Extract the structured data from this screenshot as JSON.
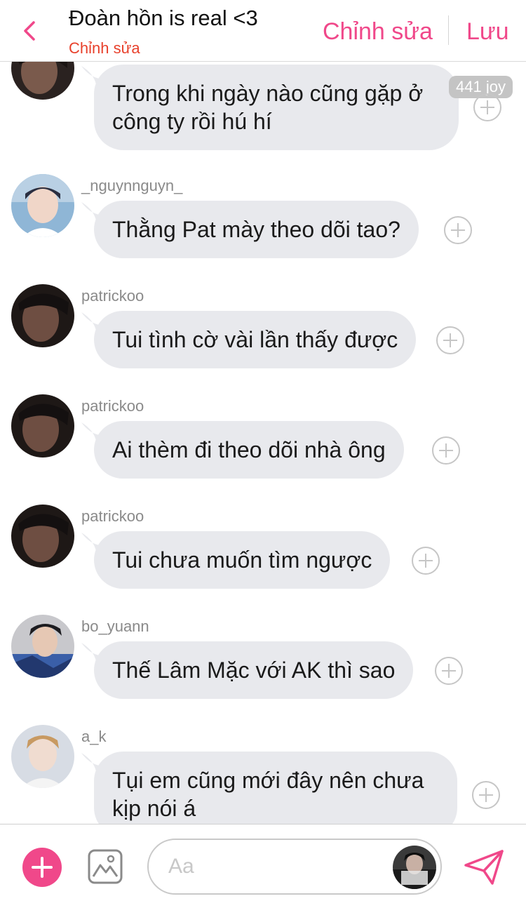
{
  "header": {
    "title": "Đoàn hồn is real <3",
    "subtitle": "Chỉnh sửa",
    "edit_label": "Chỉnh sửa",
    "save_label": "Lưu"
  },
  "messages": [
    {
      "username": "",
      "text_lines": [
        "Trong khi ngày nào cũng gặp ở",
        "công ty rồi hú hí"
      ],
      "badge": "441 joy",
      "avatar": "patrickoo"
    },
    {
      "username": "_nguynnguyn_",
      "text_lines": [
        "Thằng Pat mày theo dõi tao?"
      ],
      "avatar": "nguyn"
    },
    {
      "username": "patrickoo",
      "text_lines": [
        "Tui tình cờ vài lần thấy được"
      ],
      "avatar": "patrickoo"
    },
    {
      "username": "patrickoo",
      "text_lines": [
        "Ai thèm đi theo dõi nhà ông"
      ],
      "avatar": "patrickoo"
    },
    {
      "username": "patrickoo",
      "text_lines": [
        "Tui chưa muốn tìm ngược"
      ],
      "avatar": "patrickoo"
    },
    {
      "username": "bo_yuann",
      "text_lines": [
        "Thế Lâm Mặc với AK thì sao"
      ],
      "avatar": "bo_yuann"
    },
    {
      "username": "a_k",
      "text_lines": [
        "Tụi em cũng mới đây nên chưa",
        "kịp nói á"
      ],
      "avatar": "a_k"
    }
  ],
  "composer": {
    "placeholder": "Aa"
  },
  "colors": {
    "accent": "#f0488a",
    "subtitle": "#e8412c",
    "bubble": "#e8e9ed"
  },
  "icons": {
    "back": "chevron-left-icon",
    "add": "plus-icon",
    "image": "image-icon",
    "send": "send-icon",
    "react": "plus-circle-icon"
  }
}
